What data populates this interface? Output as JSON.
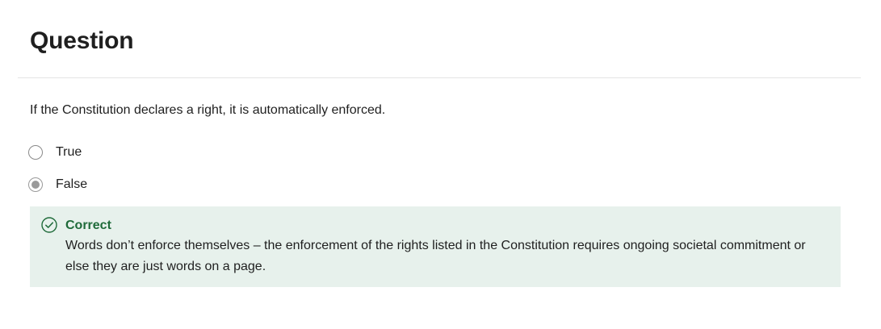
{
  "question": {
    "title": "Question",
    "prompt": "If the Constitution declares a right, it is automatically enforced.",
    "options": [
      {
        "label": "True",
        "selected": false
      },
      {
        "label": "False",
        "selected": true
      }
    ]
  },
  "feedback": {
    "status_icon": "check-circle-icon",
    "heading": "Correct",
    "text": "Words don’t enforce themselves – the enforcement of the rights listed in the Constitution requires ongoing societal commitment or else they are just words on a page.",
    "colors": {
      "background": "#e7f1ec",
      "accent": "#1f6b3a"
    }
  }
}
